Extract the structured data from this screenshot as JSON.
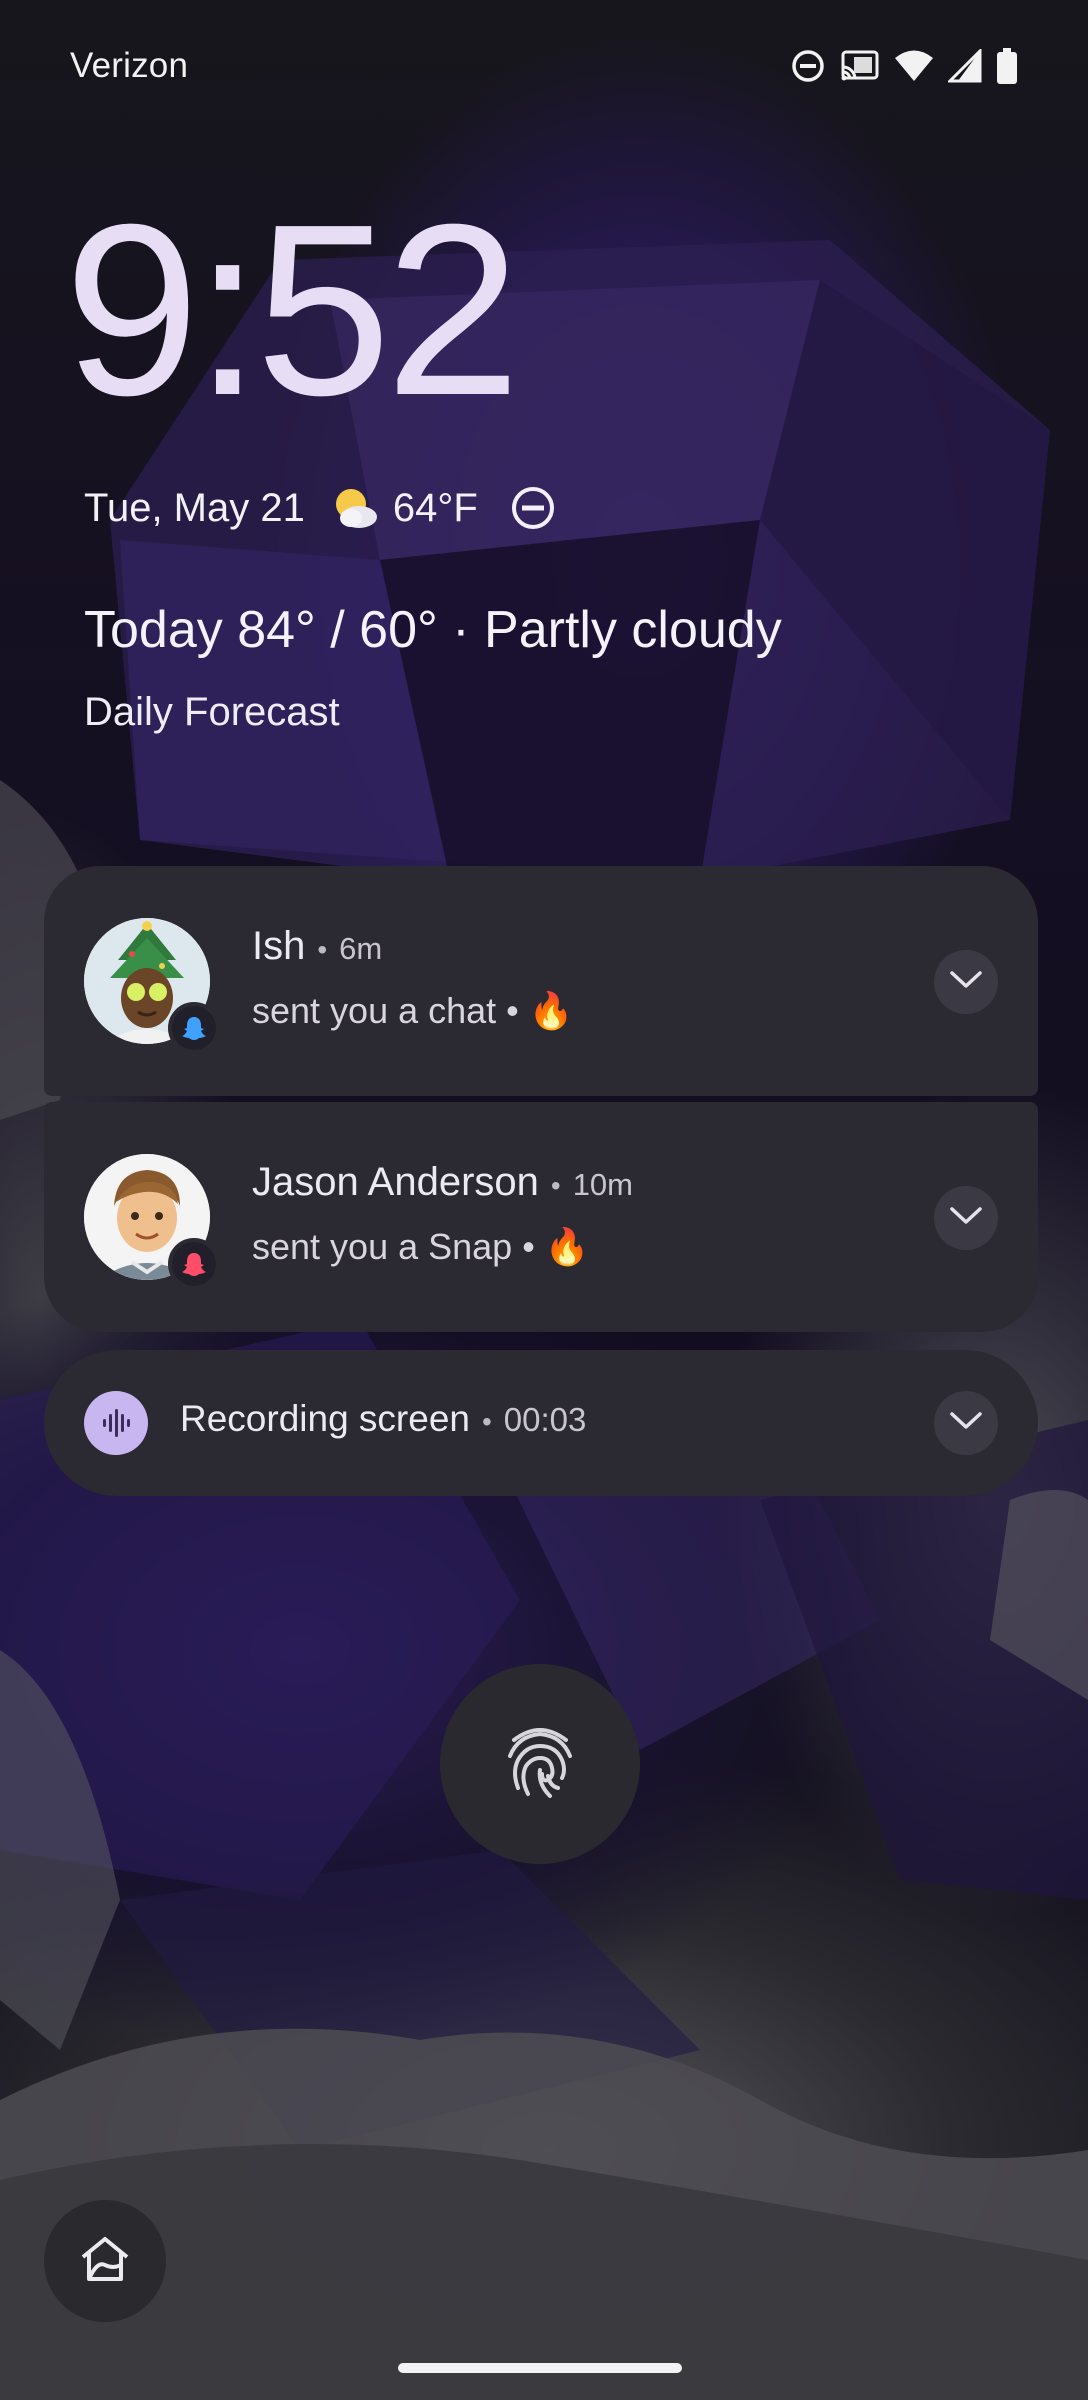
{
  "status_bar": {
    "carrier": "Verizon",
    "icons": [
      "dnd-icon",
      "cast-icon",
      "wifi-icon",
      "cell-signal-icon",
      "battery-icon"
    ]
  },
  "lockscreen": {
    "time": "9:52",
    "date": "Tue, May 21",
    "temperature": "64°F",
    "weather_icon": "partly-cloudy-icon",
    "forecast": "Today 84° / 60° · Partly cloudy",
    "forecast_link": "Daily Forecast"
  },
  "notifications": [
    {
      "sender": "Ish",
      "separator": "•",
      "time": "6m",
      "message": "sent you a chat •",
      "emoji": "🔥",
      "app_icon": "snapchat-icon",
      "app_color": "#3ea0ff"
    },
    {
      "sender": "Jason Anderson",
      "separator": "•",
      "time": "10m",
      "message": "sent you a Snap •",
      "emoji": "🔥",
      "app_icon": "snapchat-icon",
      "app_color": "#ff4d6a"
    }
  ],
  "recording": {
    "title": "Recording screen",
    "separator": "•",
    "elapsed": "00:03"
  },
  "colors": {
    "clock": "#e7def5",
    "card": "#2b2931",
    "recording_accent": "#c8b6f0"
  }
}
